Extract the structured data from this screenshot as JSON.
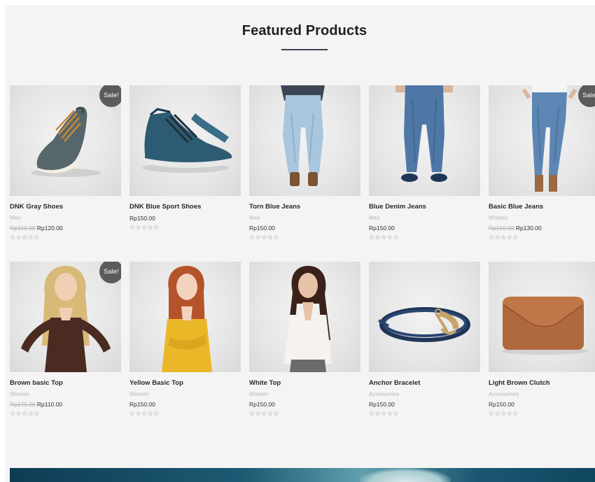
{
  "section": {
    "title": "Featured Products"
  },
  "colors": {
    "sale_badge": "#5b5b5b",
    "banner": "#0e3c54",
    "underline": "#3a4450"
  },
  "products": [
    {
      "name": "DNK Gray Shoes",
      "category": "Men",
      "old_price": "Rp150.00",
      "price": "Rp120.00",
      "sale": "Sale!",
      "rating": "☆☆☆☆☆",
      "image": "gray-shoe"
    },
    {
      "name": "DNK Blue Sport Shoes",
      "category": "",
      "old_price": "",
      "price": "Rp150.00",
      "sale": "",
      "rating": "☆☆☆☆☆",
      "image": "blue-sneaker"
    },
    {
      "name": "Torn Blue Jeans",
      "category": "Men",
      "old_price": "",
      "price": "Rp150.00",
      "sale": "",
      "rating": "☆☆☆☆☆",
      "image": "light-jeans"
    },
    {
      "name": "Blue Denim Jeans",
      "category": "Men",
      "old_price": "",
      "price": "Rp150.00",
      "sale": "",
      "rating": "☆☆☆☆☆",
      "image": "denim-jeans"
    },
    {
      "name": "Basic Blue Jeans",
      "category": "Women",
      "old_price": "Rp150.00",
      "price": "Rp130.00",
      "sale": "Sale!",
      "rating": "☆☆☆☆☆",
      "image": "women-jeans"
    },
    {
      "name": "Brown basic Top",
      "category": "Women",
      "old_price": "Rp175.00",
      "price": "Rp110.00",
      "sale": "Sale!",
      "rating": "☆☆☆☆☆",
      "image": "brown-top"
    },
    {
      "name": "Yellow Basic Top",
      "category": "Women",
      "old_price": "",
      "price": "Rp150.00",
      "sale": "",
      "rating": "☆☆☆☆☆",
      "image": "yellow-top"
    },
    {
      "name": "White Top",
      "category": "Women",
      "old_price": "",
      "price": "Rp150.00",
      "sale": "",
      "rating": "☆☆☆☆☆",
      "image": "white-top"
    },
    {
      "name": "Anchor Bracelet",
      "category": "Accessories",
      "old_price": "",
      "price": "Rp150.00",
      "sale": "",
      "rating": "☆☆☆☆☆",
      "image": "anchor-bracelet"
    },
    {
      "name": "Light Brown Clutch",
      "category": "Accessories",
      "old_price": "",
      "price": "Rp150.00",
      "sale": "",
      "rating": "☆☆☆☆☆",
      "image": "brown-clutch"
    }
  ]
}
